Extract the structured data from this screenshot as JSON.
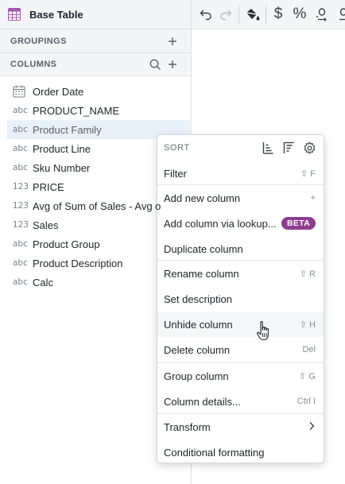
{
  "panel": {
    "title": "Base Table",
    "groupings_label": "GROUPINGS",
    "columns_label": "COLUMNS"
  },
  "columns": [
    {
      "type": "",
      "icon": "calendar-icon",
      "name": "Order Date"
    },
    {
      "type": "abc",
      "name": "PRODUCT_NAME"
    },
    {
      "type": "abc",
      "name": "Product Family",
      "selected": true
    },
    {
      "type": "abc",
      "name": "Product Line"
    },
    {
      "type": "abc",
      "name": "Sku Number"
    },
    {
      "type": "123",
      "name": "PRICE"
    },
    {
      "type": "123",
      "name": "Avg of Sum of Sales - Avg o"
    },
    {
      "type": "123",
      "name": "Sales"
    },
    {
      "type": "abc",
      "name": "Product Group"
    },
    {
      "type": "abc",
      "name": "Product Description"
    },
    {
      "type": "abc",
      "name": "Calc"
    }
  ],
  "toolbar": {
    "icons": [
      "undo-icon",
      "redo-icon",
      "paint-bucket-icon",
      "dollar-icon",
      "percent-icon",
      "decimal-icon",
      "more-icon"
    ],
    "dollar": "$",
    "percent": "%"
  },
  "menu": {
    "sort_label": "SORT",
    "filter": {
      "label": "Filter",
      "shortcut": "⇧ F"
    },
    "add_column": {
      "label": "Add new column",
      "shortcut": "+"
    },
    "add_lookup": {
      "label": "Add column via lookup...",
      "badge": "BETA"
    },
    "duplicate": {
      "label": "Duplicate column"
    },
    "rename": {
      "label": "Rename column",
      "shortcut": "⇧ R"
    },
    "set_description": {
      "label": "Set description"
    },
    "unhide": {
      "label": "Unhide column",
      "shortcut": "⇧ H"
    },
    "delete": {
      "label": "Delete column",
      "shortcut": "Del"
    },
    "group": {
      "label": "Group column",
      "shortcut": "⇧ G"
    },
    "details": {
      "label": "Column details...",
      "shortcut": "Ctrl I"
    },
    "transform": {
      "label": "Transform"
    },
    "conditional": {
      "label": "Conditional formatting"
    }
  },
  "colors": {
    "accent": "#8e3d8e",
    "selection": "#e8f0fa",
    "panel_bg": "#f4f5f6"
  }
}
